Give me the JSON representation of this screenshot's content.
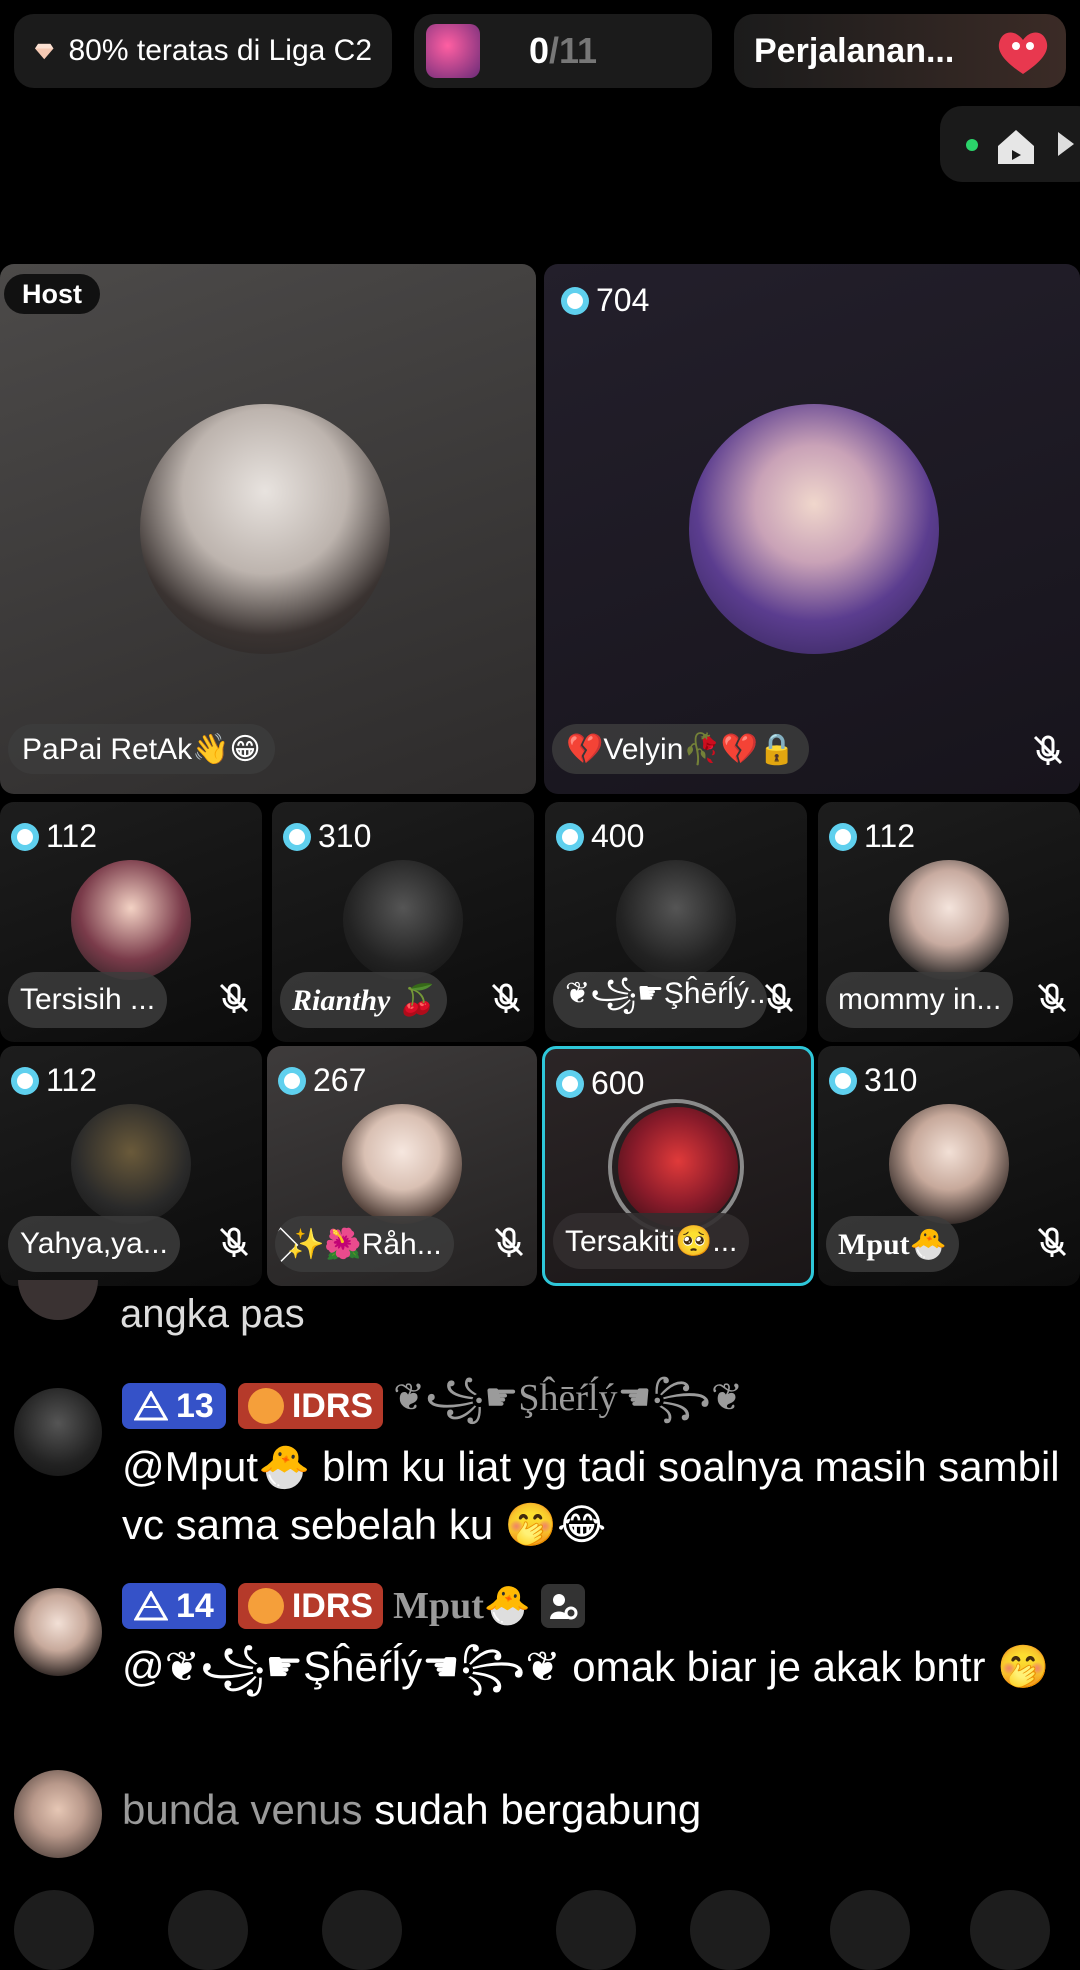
{
  "top_bar": {
    "league_text": "80% teratas di Liga C2",
    "count_current": "0",
    "count_total": "/11",
    "journey_text": "Perjalanan..."
  },
  "icons": {
    "diamond": "diamond-icon",
    "home": "home-icon",
    "arrow": "play-arrow-icon",
    "coin": "coin-icon",
    "mute": "mic-muted-icon",
    "level": "level-triangle-icon",
    "role": "host-role-icon"
  },
  "colors": {
    "background": "#000000",
    "coin": "#5fd0ee",
    "level_badge": "#3552c8",
    "idrs_badge": "#b53a2a",
    "highlight_border": "#2ec7d9",
    "online_dot": "#2bd36a"
  },
  "seats": [
    {
      "badge": "Host",
      "name": "PaPai RetAk👋😁"
    },
    {
      "coins": "704",
      "name": "💔Velyin🥀💔🔒"
    },
    {
      "coins": "112",
      "name": "Tersisih ..."
    },
    {
      "coins": "310",
      "name": "Rianthy 🍒"
    },
    {
      "coins": "400",
      "name": "❦꧁☛Şĥēŕĺý..."
    },
    {
      "coins": "112",
      "name": "mommy in..."
    },
    {
      "coins": "112",
      "name": "Yahya,ya..."
    },
    {
      "coins": "267",
      "name": "⃟✨🌺Råh..."
    },
    {
      "coins": "600",
      "name": "Tersakiti🥺..."
    },
    {
      "coins": "310",
      "name": "Mput🐣"
    }
  ],
  "chat": {
    "partial_text": "angka pas",
    "messages": [
      {
        "level": "13",
        "tag": "IDRS",
        "sender": "❦꧁☛Şĥēŕĺý☚꧂❦",
        "text": "@Mput🐣 blm ku liat yg tadi soalnya masih sambil vc sama sebelah ku 🤭😂"
      },
      {
        "level": "14",
        "tag": "IDRS",
        "sender": "Mput🐣",
        "text": "@❦꧁☛Şĥēŕĺý☚꧂❦ omak biar je akak bntr 🤭"
      }
    ],
    "join": {
      "name": "bunda venus",
      "text": "sudah bergabung"
    }
  }
}
